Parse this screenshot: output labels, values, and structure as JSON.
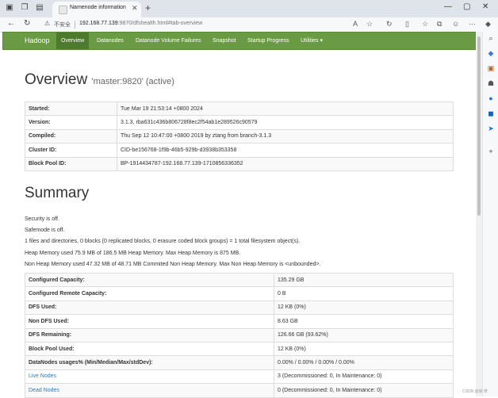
{
  "browser": {
    "tab_title": "Namenode information",
    "insecure_label": "不安全",
    "url_host": "192.168.77.139",
    "url_rest": ":9870/dfshealth.html#tab-overview"
  },
  "navbar": {
    "brand": "Hadoop",
    "items": [
      "Overview",
      "Datanodes",
      "Datanode Volume Failures",
      "Snapshot",
      "Startup Progress",
      "Utilities ▾"
    ]
  },
  "overview": {
    "title": "Overview",
    "subtitle": "'master:9820' (active)",
    "rows": [
      {
        "label": "Started:",
        "value": "Tue Mar 19 21:53:14 +0800 2024"
      },
      {
        "label": "Version:",
        "value": "3.1.3, rba631c436b806728f8ec2f54ab1e289526c90579"
      },
      {
        "label": "Compiled:",
        "value": "Thu Sep 12 10:47:00 +0800 2019 by ztang from branch-3.1.3"
      },
      {
        "label": "Cluster ID:",
        "value": "CID-be156768-1f9b-46b5-929b-d3938b353358"
      },
      {
        "label": "Block Pool ID:",
        "value": "BP-1914434787-192.168.77.139-1710856336352"
      }
    ]
  },
  "summary": {
    "title": "Summary",
    "lines": [
      "Security is off.",
      "Safemode is off.",
      "1 files and directories, 0 blocks (0 replicated blocks, 0 erasure coded block groups) = 1 total filesystem object(s).",
      "Heap Memory used 75.9 MB of 186.5 MB Heap Memory. Max Heap Memory is 875 MB.",
      "Non Heap Memory used 47.32 MB of 48.71 MB Commited Non Heap Memory. Max Non Heap Memory is <unbounded>."
    ],
    "rows": [
      {
        "label": "Configured Capacity:",
        "value": "135.29 GB"
      },
      {
        "label": "Configured Remote Capacity:",
        "value": "0 B"
      },
      {
        "label": "DFS Used:",
        "value": "12 KB (0%)"
      },
      {
        "label": "Non DFS Used:",
        "value": "8.63 GB"
      },
      {
        "label": "DFS Remaining:",
        "value": "126.66 GB (93.62%)"
      },
      {
        "label": "Block Pool Used:",
        "value": "12 KB (0%)"
      },
      {
        "label": "DataNodes usages% (Min/Median/Max/stdDev):",
        "value": "0.00% / 0.00% / 0.00% / 0.00%"
      },
      {
        "label": "Live Nodes",
        "value": "3 (Decommissioned: 0, In Maintenance: 0)"
      },
      {
        "label": "Dead Nodes",
        "value": "0 (Decommissioned: 0, In Maintenance: 0)"
      }
    ]
  },
  "watermark": "CSDN @柒 奇"
}
